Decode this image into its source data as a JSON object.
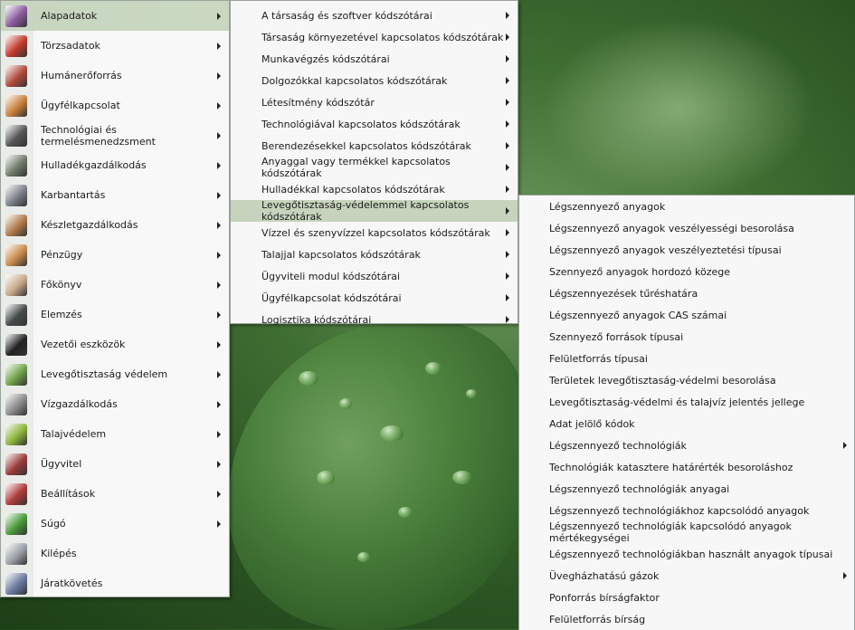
{
  "menu1": [
    {
      "label": "Alapadatok",
      "icon": "books-icon",
      "color": "#8a5a9e",
      "arrow": true,
      "active": true
    },
    {
      "label": "Törzsadatok",
      "icon": "binders-icon",
      "color": "#c23a2a",
      "arrow": true
    },
    {
      "label": "Humánerőforrás",
      "icon": "people-icon",
      "color": "#b04a3a",
      "arrow": true
    },
    {
      "label": "Ügyfélkapcsolat",
      "icon": "handshake-icon",
      "color": "#c9803a",
      "arrow": true
    },
    {
      "label": "Technológiai és termelésmenedzsment",
      "icon": "tools-icon",
      "color": "#555555",
      "arrow": true
    },
    {
      "label": "Hulladékgazdálkodás",
      "icon": "trash-bin-icon",
      "color": "#6f7a6a",
      "arrow": true
    },
    {
      "label": "Karbantartás",
      "icon": "wrench-icon",
      "color": "#7a7f8a",
      "arrow": true
    },
    {
      "label": "Készletgazdálkodás",
      "icon": "boxes-icon",
      "color": "#b07a4a",
      "arrow": true
    },
    {
      "label": "Pénzügy",
      "icon": "money-icon",
      "color": "#c98a4a",
      "arrow": true
    },
    {
      "label": "Főkönyv",
      "icon": "ledger-icon",
      "color": "#c7a98a",
      "arrow": true
    },
    {
      "label": "Elemzés",
      "icon": "binoculars-icon",
      "color": "#444a4a",
      "arrow": true
    },
    {
      "label": "Vezetői eszközök",
      "icon": "managers-icon",
      "color": "#222222",
      "arrow": true
    },
    {
      "label": "Levegőtisztaság védelem",
      "icon": "leaf-air-icon",
      "color": "#6fa24a",
      "arrow": true
    },
    {
      "label": "Vízgazdálkodás",
      "icon": "water-drop-icon",
      "color": "#8a8a8a",
      "arrow": true
    },
    {
      "label": "Talajvédelem",
      "icon": "plant-icon",
      "color": "#8ab43a",
      "arrow": true
    },
    {
      "label": "Ügyvitel",
      "icon": "stamp-icon",
      "color": "#9a3a3a",
      "arrow": true
    },
    {
      "label": "Beállítások",
      "icon": "settings-icon",
      "color": "#b03a3a",
      "arrow": true
    },
    {
      "label": "Súgó",
      "icon": "help-icon",
      "color": "#4a9a3a",
      "arrow": true
    },
    {
      "label": "Kilépés",
      "icon": "exit-door-icon",
      "color": "#9aa0a6",
      "arrow": false
    },
    {
      "label": "Járatkövetés",
      "icon": "truck-map-icon",
      "color": "#6a7aa0",
      "arrow": false
    }
  ],
  "menu2": [
    {
      "label": "A társaság és szoftver kódszótárai"
    },
    {
      "label": "Társaság környezetével kapcsolatos kódszótárak"
    },
    {
      "label": "Munkavégzés kódszótárai"
    },
    {
      "label": "Dolgozókkal kapcsolatos kódszótárak"
    },
    {
      "label": "Létesítmény kódszótár"
    },
    {
      "label": "Technológiával kapcsolatos kódszótárak"
    },
    {
      "label": "Berendezésekkel kapcsolatos kódszótárak"
    },
    {
      "label": "Anyaggal vagy termékkel kapcsolatos kódszótárak"
    },
    {
      "label": "Hulladékkal kapcsolatos kódszótárak"
    },
    {
      "label": "Levegőtisztaság-védelemmel kapcsolatos kódszótárak",
      "active": true
    },
    {
      "label": "Vízzel és szenyvízzel kapcsolatos kódszótárak"
    },
    {
      "label": "Talajjal kapcsolatos kódszótárak"
    },
    {
      "label": "Ügyviteli modul kódszótárai"
    },
    {
      "label": "Ügyfélkapcsolat kódszótárai"
    },
    {
      "label": "Logisztika kódszótárai"
    }
  ],
  "menu3": [
    {
      "label": "Légszennyező anyagok",
      "arrow": false
    },
    {
      "label": "Légszennyező anyagok veszélyességi besorolása",
      "arrow": false
    },
    {
      "label": "Légszennyező anyagok veszélyeztetési típusai",
      "arrow": false
    },
    {
      "label": "Szennyező anyagok hordozó közege",
      "arrow": false
    },
    {
      "label": "Légszennyezések tűréshatára",
      "arrow": false
    },
    {
      "label": "Légszennyező anyagok CAS számai",
      "arrow": false
    },
    {
      "label": "Szennyező források típusai",
      "arrow": false
    },
    {
      "label": "Felületforrás típusai",
      "arrow": false
    },
    {
      "label": "Területek levegőtisztaság-védelmi besorolása",
      "arrow": false
    },
    {
      "label": "Levegőtisztaság-védelmi és talajvíz jelentés jellege",
      "arrow": false
    },
    {
      "label": "Adat jelölő kódok",
      "arrow": false
    },
    {
      "label": "Légszennyező technológiák",
      "arrow": true
    },
    {
      "label": "Technológiák katasztere határérték besoroláshoz",
      "arrow": false
    },
    {
      "label": "Légszennyező technológiák anyagai",
      "arrow": false
    },
    {
      "label": "Légszennyező technológiákhoz kapcsolódó anyagok",
      "arrow": false
    },
    {
      "label": "Légszennyező technológiák kapcsolódó anyagok mértékegységei",
      "arrow": false
    },
    {
      "label": "Légszennyező technológiákban használt anyagok típusai",
      "arrow": false
    },
    {
      "label": "Üvegházhatású gázok",
      "arrow": true
    },
    {
      "label": "Ponforrás bírságfaktor",
      "arrow": false
    },
    {
      "label": "Felületforrás bírság",
      "arrow": false
    }
  ]
}
